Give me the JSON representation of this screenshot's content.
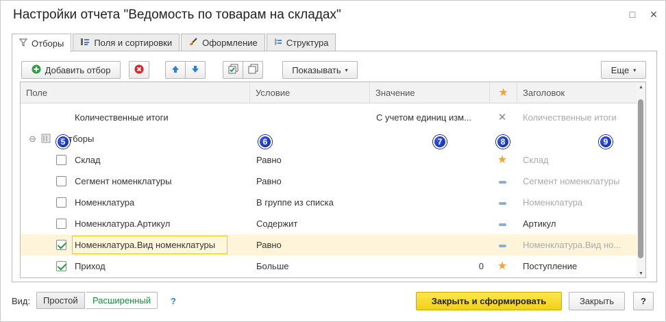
{
  "window": {
    "title": "Настройки отчета \"Ведомость по товарам на складах\"",
    "restore_glyph": "□",
    "close_glyph": "✕"
  },
  "tabs": [
    {
      "label": "Отборы",
      "icon": "filter-icon",
      "active": true
    },
    {
      "label": "Поля и сортировки",
      "icon": "fields-icon",
      "active": false
    },
    {
      "label": "Оформление",
      "icon": "brush-icon",
      "active": false
    },
    {
      "label": "Структура",
      "icon": "structure-icon",
      "active": false
    }
  ],
  "toolbar": {
    "add_filter": "Добавить отбор",
    "show": "Показывать",
    "more": "Еще"
  },
  "grid": {
    "columns": {
      "field": "Поле",
      "condition": "Условие",
      "value": "Значение",
      "heading": "Заголовок"
    },
    "totals_row": {
      "field": "Количественные итоги",
      "value": "С учетом единиц изм...",
      "heading": "Количественные итоги"
    },
    "group": {
      "label": "Отборы"
    },
    "rows": [
      {
        "field": "Склад",
        "condition": "Равно",
        "value": "",
        "mark": "star",
        "heading": "Склад",
        "checked": false,
        "heading_muted": true
      },
      {
        "field": "Сегмент номенклатуры",
        "condition": "Равно",
        "value": "",
        "mark": "dash",
        "heading": "Сегмент номенклатуры",
        "checked": false,
        "heading_muted": true
      },
      {
        "field": "Номенклатура",
        "condition": "В группе из списка",
        "value": "",
        "mark": "dash",
        "heading": "Номенклатура",
        "checked": false,
        "heading_muted": true
      },
      {
        "field": "Номенклатура.Артикул",
        "condition": "Содержит",
        "value": "",
        "mark": "dash",
        "heading": "Артикул",
        "checked": false,
        "heading_muted": false
      },
      {
        "field": "Номенклатура.Вид номенклатуры",
        "condition": "Равно",
        "value": "",
        "mark": "dash",
        "heading": "Номенклатура.Вид но...",
        "checked": true,
        "heading_muted": true
      },
      {
        "field": "Приход",
        "condition": "Больше",
        "value": "0",
        "mark": "star",
        "heading": "Поступление",
        "checked": true,
        "heading_muted": false
      }
    ]
  },
  "badges": [
    "5",
    "6",
    "7",
    "8",
    "9"
  ],
  "footer": {
    "view_label": "Вид:",
    "simple": "Простой",
    "extended": "Расширенный",
    "help": "?",
    "close_and_build": "Закрыть и сформировать",
    "close": "Закрыть",
    "help_button": "?"
  },
  "colors": {
    "accent_yellow": "#f7d626",
    "selected_row": "#fdf4d9",
    "star": "#f3a42b",
    "check": "#1e9e3e",
    "badge": "#0b1fa8"
  }
}
